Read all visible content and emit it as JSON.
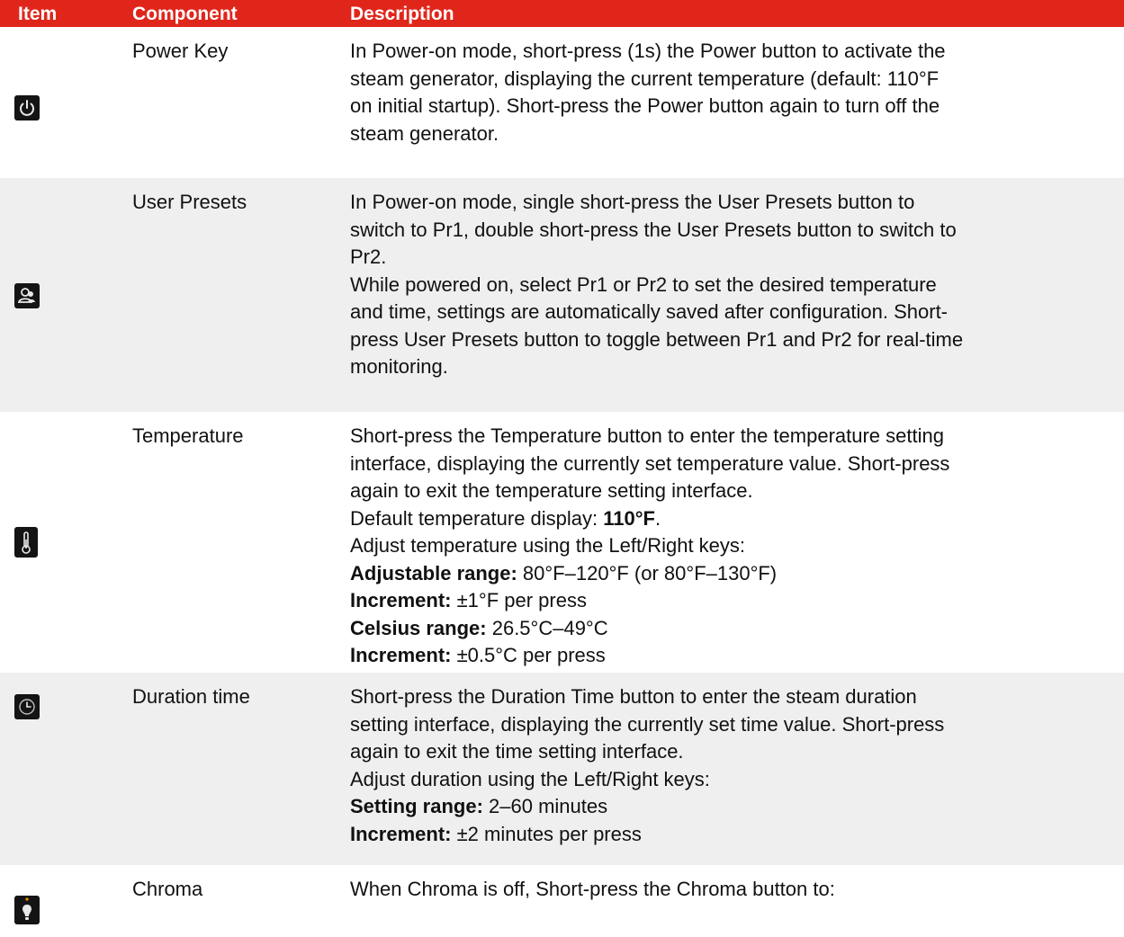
{
  "table": {
    "headers": {
      "item": "Item",
      "component": "Component",
      "description": "Description"
    },
    "rows": [
      {
        "icon": "power-icon",
        "component": "Power Key",
        "lines": [
          "In Power-on mode, short-press (1s) the Power button to activate the",
          "steam generator, displaying the current temperature (default: 110°F",
          "on initial startup). Short-press the Power button again to turn off the",
          "steam generator."
        ]
      },
      {
        "icon": "user-presets-icon",
        "component": "User Presets",
        "lines": [
          "In Power-on mode, single short-press the User Presets button to",
          "switch to Pr1, double short-press the User Presets button to switch to",
          "Pr2.",
          "While powered on, select Pr1 or Pr2 to set the desired temperature",
          "and time, settings are automatically saved after configuration. Short-",
          "press User Presets button to toggle between Pr1 and Pr2 for real-time",
          "monitoring."
        ]
      },
      {
        "icon": "thermometer-icon",
        "component": "Temperature",
        "lines": [
          "Short-press the Temperature button to enter the temperature setting",
          "interface, displaying the currently set temperature value. Short-press",
          "again to exit the temperature setting interface."
        ],
        "default_label": "Default temperature display: ",
        "default_value": "110°F",
        "adjust_line": "Adjust temperature using the Left/Right keys:",
        "specs": [
          {
            "label": "Adjustable range:",
            "value": " 80°F–120°F (or 80°F–130°F)"
          },
          {
            "label": "Increment:",
            "value": " ±1°F per press"
          },
          {
            "label": "Celsius range:",
            "value": " 26.5°C–49°C"
          },
          {
            "label": "Increment:",
            "value": " ±0.5°C per press"
          }
        ]
      },
      {
        "icon": "clock-icon",
        "component": "Duration time",
        "lines": [
          "Short-press the Duration Time button to enter the steam duration",
          "setting interface, displaying the currently set time value. Short-press",
          "again to exit the time setting interface.",
          "Adjust duration using the Left/Right keys:"
        ],
        "specs": [
          {
            "label": "Setting range:",
            "value": " 2–60 minutes"
          },
          {
            "label": "Increment:",
            "value": " ±2 minutes per press"
          }
        ]
      },
      {
        "icon": "bulb-icon",
        "component": "Chroma",
        "lines": [
          "When Chroma is off, Short-press the Chroma button to:"
        ]
      }
    ]
  },
  "colors": {
    "header_bg": "#e0261b",
    "row_shade": "#efefef",
    "icon_bg": "#141414"
  }
}
